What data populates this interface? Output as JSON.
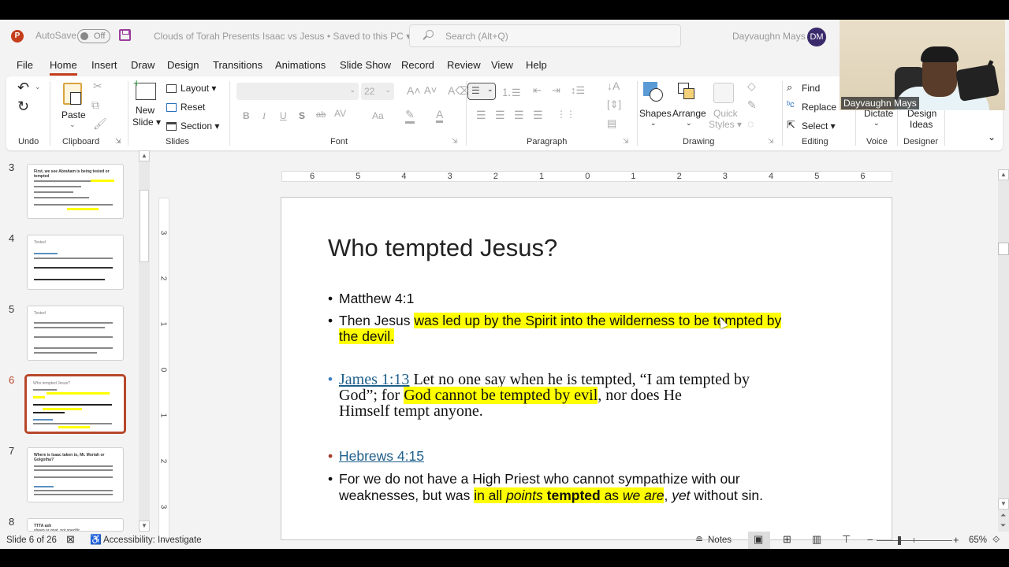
{
  "titlebar": {
    "app_logo": "P",
    "autosave_label": "AutoSave",
    "autosave_state": "Off",
    "doc_title": "Clouds of Torah Presents Isaac vs Jesus • Saved to this PC ▾",
    "search_placeholder": "Search (Alt+Q)",
    "user_name": "Dayvaughn Mays",
    "user_initials": "DM"
  },
  "menu": {
    "tabs": [
      "File",
      "Home",
      "Insert",
      "Draw",
      "Design",
      "Transitions",
      "Animations",
      "Slide Show",
      "Record",
      "Review",
      "View",
      "Help"
    ],
    "active": "Home"
  },
  "ribbon": {
    "undo": {
      "group": "Undo"
    },
    "clipboard": {
      "group": "Clipboard",
      "paste": "Paste"
    },
    "slides": {
      "group": "Slides",
      "new_slide_1": "New",
      "new_slide_2": "Slide ▾",
      "layout": "Layout ▾",
      "reset": "Reset",
      "section": "Section ▾"
    },
    "font": {
      "group": "Font",
      "font_name": "",
      "font_size": "22",
      "bold": "B",
      "italic": "I",
      "underline": "U",
      "shadow": "S",
      "strike": "ab",
      "spacing": "AV",
      "case": "Aa"
    },
    "paragraph": {
      "group": "Paragraph"
    },
    "drawing": {
      "group": "Drawing",
      "shapes": "Shapes",
      "arrange": "Arrange",
      "quick_styles_1": "Quick",
      "quick_styles_2": "Styles ▾"
    },
    "editing": {
      "group": "Editing",
      "find": "Find",
      "replace": "Replace",
      "select": "Select ▾"
    },
    "voice": {
      "group": "Voice",
      "dictate": "Dictate"
    },
    "designer": {
      "group": "Designer",
      "design_ideas_1": "Design",
      "design_ideas_2": "Ideas"
    }
  },
  "webcam": {
    "name_tag": "Dayvaughn Mays"
  },
  "thumbnails": [
    {
      "num": "3",
      "title": "First, we see Abraham is being tested or tempted"
    },
    {
      "num": "4",
      "title": "Tested"
    },
    {
      "num": "5",
      "title": "Tested"
    },
    {
      "num": "6",
      "title": "Who tempted Jesus?",
      "selected": true
    },
    {
      "num": "7",
      "title": "Where is Isaac taken to, Mt. Moriah or Golgotha?"
    },
    {
      "num": "8",
      "title": "TTTA ash",
      "subtitle": "sheep or goat, not specific"
    }
  ],
  "rulers": {
    "horizontal": [
      "6",
      "5",
      "4",
      "3",
      "2",
      "1",
      "0",
      "1",
      "2",
      "3",
      "4",
      "5",
      "6"
    ],
    "vertical": [
      "3",
      "2",
      "1",
      "0",
      "1",
      "2",
      "3"
    ]
  },
  "slide": {
    "title": "Who tempted Jesus?",
    "b1": "Matthew 4:1",
    "b2_plain": "Then Jesus ",
    "b2_hl_line1": "was led up by the Spirit into the wilderness to be tempted by",
    "b2_hl_line2": "the devil.",
    "b3_link": "James 1:13",
    "b3_l1": " Let no one say when he is tempted, “I am tempted by",
    "b3_l2_pre": "God”; for ",
    "b3_l2_hl": "God cannot be tempted by evil",
    "b3_l2_post": ", nor does He",
    "b3_l3": "Himself tempt anyone.",
    "b4_link": "Hebrews 4:15",
    "b5_l1": "For we do not have a High Priest who cannot sympathize with our",
    "b5_l2_pre": "weaknesses, but was ",
    "b5_hl_a": "in all ",
    "b5_hl_b": "points",
    "b5_hl_c": " ",
    "b5_hl_d": "tempted",
    "b5_hl_e": " as ",
    "b5_hl_f": "we are",
    "b5_post_a": ", ",
    "b5_post_b": "yet",
    "b5_post_c": " without sin."
  },
  "status": {
    "slide_info": "Slide 6 of 26",
    "accessibility": "Accessibility: Investigate",
    "notes": "Notes",
    "zoom": "65%",
    "zoom_fraction": 0.65
  },
  "colors": {
    "accent": "#c43e1c",
    "highlight": "#ffff00",
    "link": "#1f5f8b",
    "selected_thumb": "#b7472a"
  }
}
